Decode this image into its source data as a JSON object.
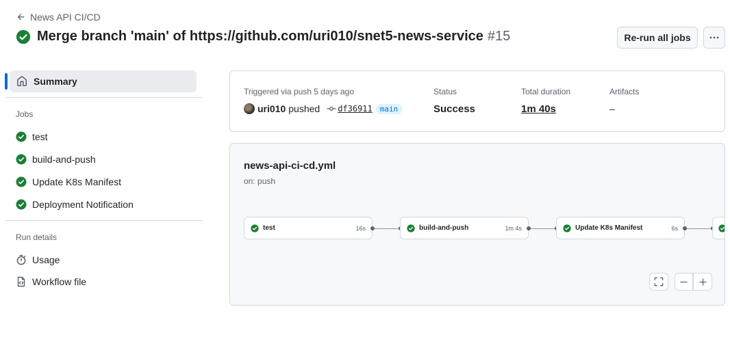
{
  "header": {
    "back_label": "News API CI/CD",
    "title": "Merge branch 'main' of https://github.com/uri010/snet5-news-service",
    "run_number": "#15",
    "rerun_label": "Re-run all jobs",
    "more_label": "···"
  },
  "sidebar": {
    "summary_label": "Summary",
    "jobs_heading": "Jobs",
    "jobs": [
      {
        "label": "test"
      },
      {
        "label": "build-and-push"
      },
      {
        "label": "Update K8s Manifest"
      },
      {
        "label": "Deployment Notification"
      }
    ],
    "run_details_heading": "Run details",
    "usage_label": "Usage",
    "workflow_file_label": "Workflow file"
  },
  "summary": {
    "trigger_label": "Triggered via push 5 days ago",
    "actor": "uri010",
    "action": "pushed",
    "commit_sha": "df36911",
    "branch": "main",
    "status_label": "Status",
    "status_value": "Success",
    "duration_label": "Total duration",
    "duration_value": "1m 40s",
    "artifacts_label": "Artifacts",
    "artifacts_value": "–"
  },
  "workflow": {
    "file_name": "news-api-ci-cd.yml",
    "trigger": "on: push",
    "jobs": [
      {
        "name": "test",
        "duration": "16s"
      },
      {
        "name": "build-and-push",
        "duration": "1m 4s"
      },
      {
        "name": "Update K8s Manifest",
        "duration": "6s"
      }
    ]
  },
  "colors": {
    "success": "#1a7f37",
    "accent": "#0969da",
    "border": "#d1d9e0",
    "muted_text": "#59636e"
  },
  "icons": {
    "back": "arrow-left-icon",
    "status": "check-circle-fill-icon",
    "summary": "home-icon",
    "usage": "stopwatch-icon",
    "workflow_file": "file-code-icon",
    "commit": "git-commit-icon",
    "fullscreen": "screen-full-icon",
    "zoom_out": "minus-icon",
    "zoom_in": "plus-icon"
  }
}
